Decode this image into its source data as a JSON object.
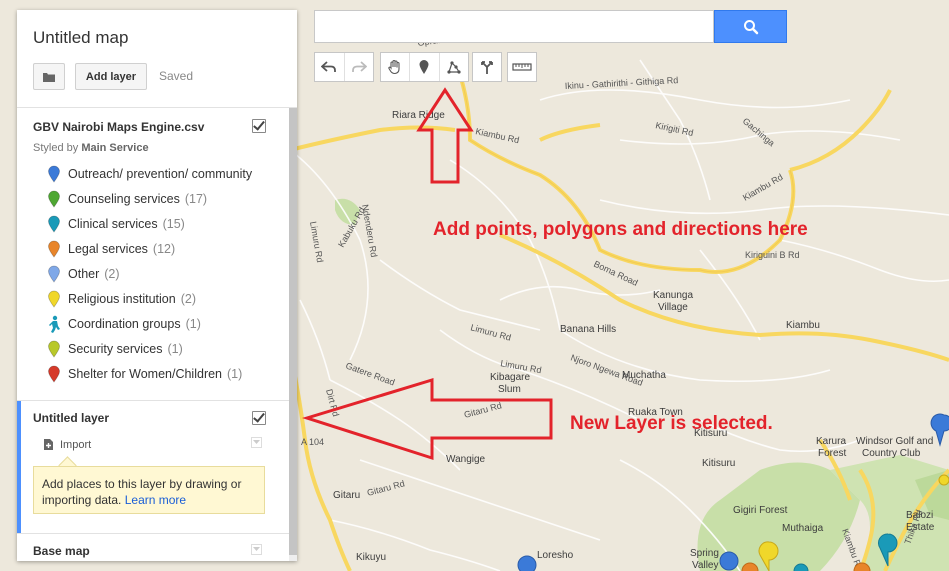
{
  "panel": {
    "map_title": "Untitled map",
    "add_layer_label": "Add layer",
    "saved_label": "Saved",
    "layer1": {
      "title": "GBV Nairobi Maps Engine.csv",
      "styled_by_prefix": "Styled by",
      "styled_by_field": "Main Service",
      "categories": [
        {
          "label": "Outreach/ prevention/ community",
          "count": "",
          "icon": "pin-blue",
          "color": "#3b7ad8"
        },
        {
          "label": "Counseling services",
          "count": "(17)",
          "icon": "pin-green",
          "color": "#4ea733"
        },
        {
          "label": "Clinical services",
          "count": "(15)",
          "icon": "pin-teal",
          "color": "#1a9ab8"
        },
        {
          "label": "Legal services",
          "count": "(12)",
          "icon": "pin-orange",
          "color": "#e8852a"
        },
        {
          "label": "Other",
          "count": "(2)",
          "icon": "pin-lightblue",
          "color": "#7fa8e8"
        },
        {
          "label": "Religious institution",
          "count": "(2)",
          "icon": "pin-yellow",
          "color": "#f0d72a"
        },
        {
          "label": "Coordination groups",
          "count": "(1)",
          "icon": "person-icon",
          "color": "#1a9ab8"
        },
        {
          "label": "Security services",
          "count": "(1)",
          "icon": "pin-yellowgreen",
          "color": "#b8c82a"
        },
        {
          "label": "Shelter for Women/Children",
          "count": "(1)",
          "icon": "pin-red",
          "color": "#d63a2a"
        }
      ]
    },
    "layer2": {
      "title": "Untitled layer",
      "import_label": "Import",
      "hint_text": "Add places to this layer by drawing or importing data. ",
      "learn_more": "Learn more"
    },
    "basemap_title": "Base map"
  },
  "search": {
    "placeholder": ""
  },
  "toolbar": {
    "icons": [
      "undo-icon",
      "redo-icon",
      "hand-icon",
      "marker-icon",
      "line-icon",
      "directions-icon",
      "ruler-icon"
    ]
  },
  "annotations": {
    "top": "Add points, polygons and directions here",
    "right": "New Layer is selected."
  },
  "map_labels": {
    "riara_ridge": "Riara Ridge",
    "kiambu_rd_1": "Kiambu Rd",
    "kiambu_rd_2": "Kiambu Rd",
    "kiambu_rd_3": "Kiambu Rd",
    "ikinu": "Ikinu - Gathirithi - Githiga Rd",
    "kirigiti": "Kirigiti Rd",
    "gachinga": "Gachinga",
    "kiriguini": "Kiriguini B Rd",
    "boma_rd": "Boma Road",
    "kanunga": "Kanunga",
    "village": "Village",
    "kiambu": "Kiambu",
    "banana_hills": "Banana Hills",
    "limuru_rd_1": "Limuru Rd",
    "limuru_rd_2": "Limuru Rd",
    "limuru_rd_3": "Limuru Rd",
    "kabuku": "Kabuku Rd",
    "ndenderu": "Ndenderu Rd",
    "njoro": "Njoro Ngewa Road",
    "muchatha": "Muchatha",
    "kibagare": "Kibagare",
    "slum": "Slum",
    "ruaka_town": "Ruaka Town",
    "gatere": "Gatere Road",
    "dirt_rd": "Dirt Rd",
    "gitaru_rd_1": "Gitaru Rd",
    "gitaru_rd_2": "Gitaru Rd",
    "gitaru": "Gitaru",
    "wangige": "Wangige",
    "a104": "A 104",
    "kitisuru_1": "Kitisuru",
    "kitisuru_2": "Kitisuru",
    "kikuyu": "Kikuyu",
    "loresho": "Loresho",
    "gigiri_forest": "Gigiri Forest",
    "karura": "Karura",
    "forest": "Forest",
    "muthaiga": "Muthaiga",
    "spring": "Spring",
    "valley": "Valley",
    "windsor": "Windsor Golf and",
    "country_club": "Country Club",
    "balozi": "Balozi",
    "estate": "Estate",
    "thika_rd": "Thika Rd",
    "kiambu_rd_vert": "Kiambu Rd",
    "upper_road": "Opratha Rd"
  }
}
